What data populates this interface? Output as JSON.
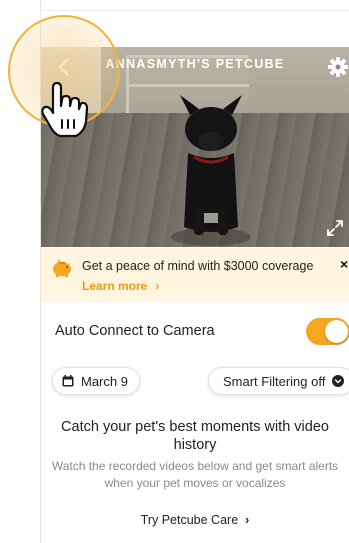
{
  "camera": {
    "title": "ANNASMYTH'S PETCUBE",
    "back_icon": "chevron-left-icon",
    "settings_icon": "gear-icon",
    "expand_icon": "expand-icon"
  },
  "banner": {
    "icon": "piggy-bank-icon",
    "text": "Get a peace of mind with $3000 coverage",
    "link": "Learn more",
    "link_chevron": "›",
    "close": "×"
  },
  "auto_connect": {
    "label": "Auto Connect to Camera",
    "enabled": true
  },
  "filters": {
    "date_icon": "calendar-icon",
    "date": "March 9",
    "smart_filter": "Smart Filtering off",
    "smart_filter_icon": "chevron-down-icon"
  },
  "promo": {
    "title": "Catch your pet's best moments with video history",
    "body": "Watch the recorded videos below and get smart alerts when your pet moves or vocalizes",
    "cta": "Try Petcube Care",
    "cta_chevron": "›"
  },
  "colors": {
    "accent": "#f5a623",
    "banner_bg": "#fff5de",
    "link": "#f09a12"
  }
}
